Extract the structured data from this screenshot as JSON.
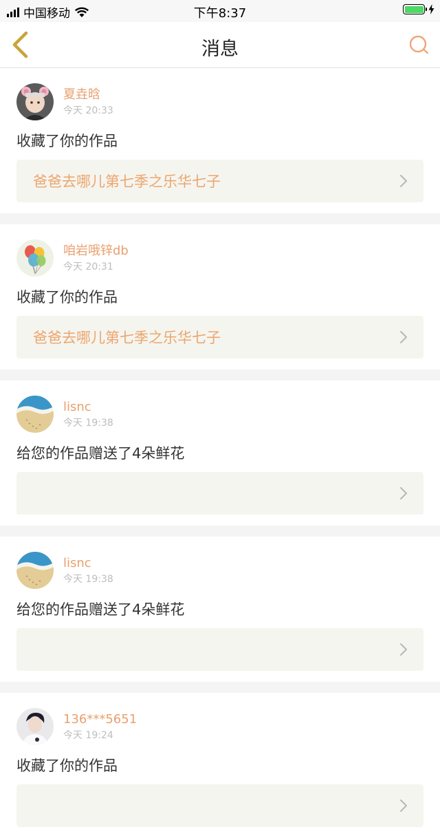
{
  "status_bar": {
    "carrier": "中国移动",
    "time": "下午8:37"
  },
  "nav": {
    "title": "消息",
    "back_icon": "chevron-left-icon",
    "search_icon": "search-icon"
  },
  "colors": {
    "accent": "#e9a06e",
    "work_bg": "#f5f5ef",
    "back_icon": "#c8a53a"
  },
  "messages": [
    {
      "name": "夏垚晗",
      "time": "今天 20:33",
      "action": "收藏了你的作品",
      "work": "爸爸去哪儿第七季之乐华七子",
      "avatar": "bear-ears-baby"
    },
    {
      "name": "咱岩哦锌db",
      "time": "今天 20:31",
      "action": "收藏了你的作品",
      "work": "爸爸去哪儿第七季之乐华七子",
      "avatar": "balloons"
    },
    {
      "name": "lisnc",
      "time": "今天 19:38",
      "action": "给您的作品赠送了4朵鲜花",
      "work": "",
      "avatar": "beach"
    },
    {
      "name": "lisnc",
      "time": "今天 19:38",
      "action": "给您的作品赠送了4朵鲜花",
      "work": "",
      "avatar": "beach"
    },
    {
      "name": "136***5651",
      "time": "今天 19:24",
      "action": "收藏了你的作品",
      "work": "",
      "avatar": "portrait"
    }
  ]
}
